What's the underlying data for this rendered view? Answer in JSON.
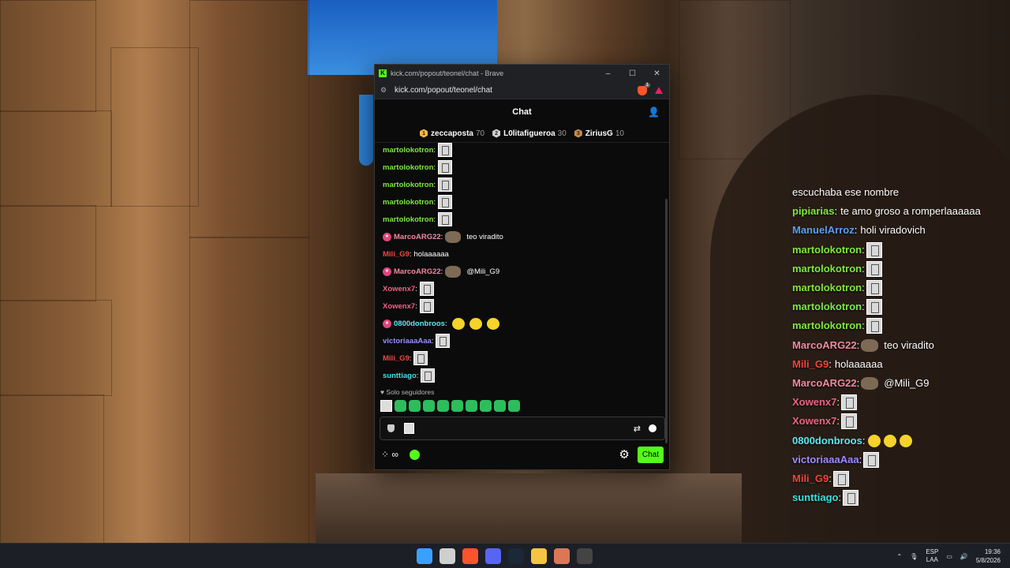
{
  "window": {
    "title": "kick.com/popout/teonel/chat - Brave",
    "url": "kick.com/popout/teonel/chat",
    "brave_badge": "1"
  },
  "chat": {
    "header": "Chat",
    "pinned": [
      {
        "rank": "1",
        "name": "zeccaposta",
        "points": "70",
        "color": "#f5b942"
      },
      {
        "rank": "2",
        "name": "L0litafigueroa",
        "points": "30",
        "color": "#d0d0d0"
      },
      {
        "rank": "3",
        "name": "ZiriusG",
        "points": "10",
        "color": "#c98a4b"
      }
    ],
    "messages": [
      {
        "user": "martolokotron",
        "color": "#7ee83e",
        "text": "",
        "emotes": [
          "emote"
        ]
      },
      {
        "user": "martolokotron",
        "color": "#7ee83e",
        "text": "",
        "emotes": [
          "emote"
        ]
      },
      {
        "user": "martolokotron",
        "color": "#7ee83e",
        "text": "",
        "emotes": [
          "emote"
        ]
      },
      {
        "user": "martolokotron",
        "color": "#7ee83e",
        "text": "",
        "emotes": [
          "emote"
        ]
      },
      {
        "user": "martolokotron",
        "color": "#7ee83e",
        "text": "",
        "emotes": [
          "emote"
        ]
      },
      {
        "user": "MarcoARG22",
        "color": "#f08aa0",
        "badge": true,
        "text": "teo viradito",
        "emotes": [
          "brown"
        ]
      },
      {
        "user": "Mili_G9",
        "color": "#f2453d",
        "text": "holaaaaaa",
        "emotes": []
      },
      {
        "user": "MarcoARG22",
        "color": "#f08aa0",
        "badge": true,
        "text": "@Mili_G9",
        "emotes": [
          "brown"
        ]
      },
      {
        "user": "Xowenx7",
        "color": "#f06283",
        "text": "",
        "emotes": [
          "emote"
        ]
      },
      {
        "user": "Xowenx7",
        "color": "#f06283",
        "text": "",
        "emotes": [
          "emote"
        ]
      },
      {
        "user": "0800donbroos",
        "color": "#5ee8f0",
        "badge": true,
        "text": "",
        "emotes": [
          "yellow",
          "yellow",
          "yellow"
        ]
      },
      {
        "user": "victoriaaaAaa",
        "color": "#9b8cff",
        "text": "",
        "emotes": [
          "emote"
        ]
      },
      {
        "user": "Mili_G9",
        "color": "#f2453d",
        "text": "",
        "emotes": [
          "emote"
        ]
      },
      {
        "user": "sunttiago",
        "color": "#3fe0e0",
        "text": "",
        "emotes": [
          "emote"
        ]
      }
    ],
    "followers_only": "Solo seguidores",
    "points_label": "∞",
    "send_label": "Chat"
  },
  "overlay": {
    "partial_line": "escuchaba ese nombre",
    "messages": [
      {
        "user": "pipiarias",
        "color": "#7ee83e",
        "text": "te amo groso a romperlaaaaaa",
        "emotes": []
      },
      {
        "user": "ManuelArroz",
        "color": "#5aa0f0",
        "text": "holi viradovich",
        "emotes": []
      },
      {
        "user": "martolokotron",
        "color": "#7ee83e",
        "text": "",
        "emotes": [
          "emote"
        ]
      },
      {
        "user": "martolokotron",
        "color": "#7ee83e",
        "text": "",
        "emotes": [
          "emote"
        ]
      },
      {
        "user": "martolokotron",
        "color": "#7ee83e",
        "text": "",
        "emotes": [
          "emote"
        ]
      },
      {
        "user": "martolokotron",
        "color": "#7ee83e",
        "text": "",
        "emotes": [
          "emote"
        ]
      },
      {
        "user": "martolokotron",
        "color": "#7ee83e",
        "text": "",
        "emotes": [
          "emote"
        ]
      },
      {
        "user": "MarcoARG22",
        "color": "#f08aa0",
        "text": "teo viradito",
        "emotes": [
          "brown"
        ]
      },
      {
        "user": "Mili_G9",
        "color": "#f2453d",
        "text": "holaaaaaa",
        "emotes": []
      },
      {
        "user": "MarcoARG22",
        "color": "#f08aa0",
        "text": "@Mili_G9",
        "emotes": [
          "brown"
        ]
      },
      {
        "user": "Xowenx7",
        "color": "#f06283",
        "text": "",
        "emotes": [
          "emote"
        ]
      },
      {
        "user": "Xowenx7",
        "color": "#f06283",
        "text": "",
        "emotes": [
          "emote"
        ]
      },
      {
        "user": "0800donbroos",
        "color": "#5ee8f0",
        "text": "",
        "emotes": [
          "yellow",
          "yellow",
          "yellow"
        ]
      },
      {
        "user": "victoriaaaAaa",
        "color": "#9b8cff",
        "text": "",
        "emotes": [
          "emote"
        ]
      },
      {
        "user": "Mili_G9",
        "color": "#f2453d",
        "text": "",
        "emotes": [
          "emote"
        ]
      },
      {
        "user": "sunttiago",
        "color": "#3fe0e0",
        "text": "",
        "emotes": [
          "emote"
        ]
      }
    ]
  },
  "taskbar": {
    "lang_top": "ESP",
    "lang_bottom": "LAA",
    "time": "19:36",
    "date": "5/8/2026",
    "apps": [
      {
        "name": "start-icon",
        "color": "#3aa0ff"
      },
      {
        "name": "search-icon",
        "color": "#cfcfcf"
      },
      {
        "name": "brave-icon",
        "color": "#fb542b"
      },
      {
        "name": "discord-icon",
        "color": "#5865f2"
      },
      {
        "name": "steam-icon",
        "color": "#1b2838"
      },
      {
        "name": "folder-icon",
        "color": "#f5c542"
      },
      {
        "name": "claude-icon",
        "color": "#d97757"
      },
      {
        "name": "obs-icon",
        "color": "#444"
      }
    ]
  }
}
